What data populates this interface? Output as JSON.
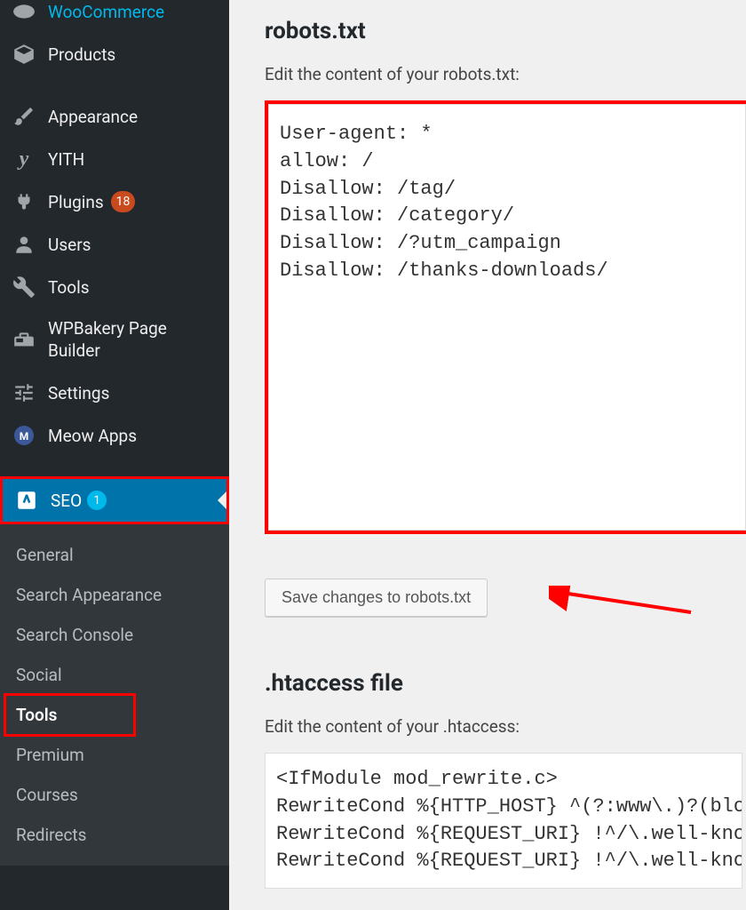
{
  "sidebar": {
    "items": [
      {
        "icon": "woo-icon",
        "label": "WooCommerce"
      },
      {
        "icon": "box-icon",
        "label": "Products"
      },
      {
        "icon": "brush-icon",
        "label": "Appearance"
      },
      {
        "icon": "yith-icon",
        "label": "YITH"
      },
      {
        "icon": "plug-icon",
        "label": "Plugins",
        "badge": "18"
      },
      {
        "icon": "user-icon",
        "label": "Users"
      },
      {
        "icon": "wrench-icon",
        "label": "Tools"
      },
      {
        "icon": "wpbakery-icon",
        "label": "WPBakery Page Builder"
      },
      {
        "icon": "sliders-icon",
        "label": "Settings"
      },
      {
        "icon": "meow-icon",
        "label": "Meow Apps"
      },
      {
        "icon": "yoast-icon",
        "label": "SEO",
        "badge_blue": "1",
        "active": true
      }
    ]
  },
  "submenu": {
    "items": [
      {
        "label": "General"
      },
      {
        "label": "Search Appearance"
      },
      {
        "label": "Search Console"
      },
      {
        "label": "Social"
      },
      {
        "label": "Tools",
        "selected": true
      },
      {
        "label": "Premium"
      },
      {
        "label": "Courses"
      },
      {
        "label": "Redirects"
      }
    ]
  },
  "robots": {
    "heading": "robots.txt",
    "desc": "Edit the content of your robots.txt:",
    "content": "User-agent: *\nallow: /\nDisallow: /tag/\nDisallow: /category/\nDisallow: /?utm_campaign\nDisallow: /thanks-downloads/",
    "save_label": "Save changes to robots.txt"
  },
  "htaccess": {
    "heading": ".htaccess file",
    "desc": "Edit the content of your .htaccess:",
    "content": "<IfModule mod_rewrite.c>\nRewriteCond %{HTTP_HOST} ^(?:www\\.)?(blog)\\\nRewriteCond %{REQUEST_URI} !^/\\.well-known/\nRewriteCond %{REQUEST_URI} !^/\\.well-known/"
  }
}
